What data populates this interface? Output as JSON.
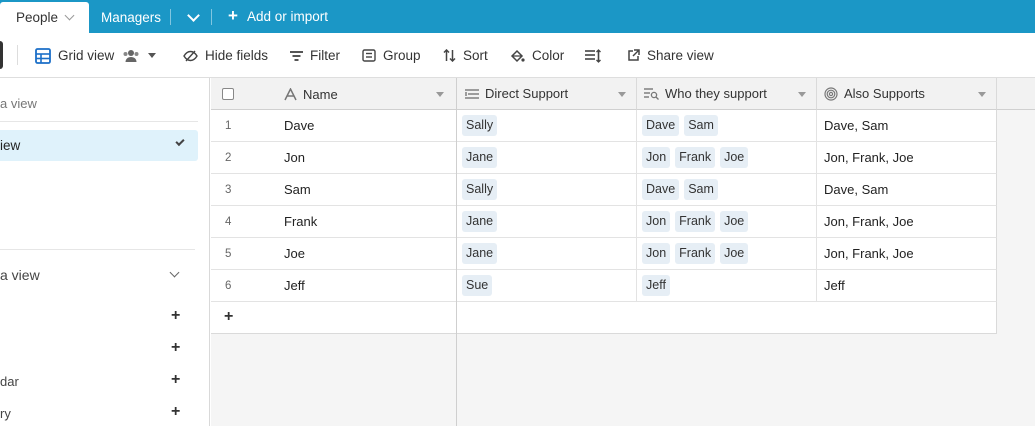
{
  "tabs": {
    "active": "People",
    "other": "Managers",
    "add_import": "Add or import"
  },
  "toolbar": {
    "view_name": "Grid view",
    "hide_fields": "Hide fields",
    "filter": "Filter",
    "group": "Group",
    "sort": "Sort",
    "color": "Color",
    "share_view": "Share view"
  },
  "sidebar": {
    "find_view": "a view",
    "active_view": "iew",
    "create_view": "a view",
    "create_items": [
      {
        "label": ""
      },
      {
        "label": ""
      },
      {
        "label": "dar"
      },
      {
        "label": "ry"
      }
    ]
  },
  "columns": {
    "name": "Name",
    "direct_support": "Direct Support",
    "who_they_support": "Who they support",
    "also_supports": "Also Supports"
  },
  "rows": [
    {
      "num": "1",
      "name": "Dave",
      "direct": [
        "Sally"
      ],
      "who": [
        "Dave",
        "Sam"
      ],
      "also": "Dave, Sam"
    },
    {
      "num": "2",
      "name": "Jon",
      "direct": [
        "Jane"
      ],
      "who": [
        "Jon",
        "Frank",
        "Joe"
      ],
      "also": "Jon, Frank, Joe"
    },
    {
      "num": "3",
      "name": "Sam",
      "direct": [
        "Sally"
      ],
      "who": [
        "Dave",
        "Sam"
      ],
      "also": "Dave, Sam"
    },
    {
      "num": "4",
      "name": "Frank",
      "direct": [
        "Jane"
      ],
      "who": [
        "Jon",
        "Frank",
        "Joe"
      ],
      "also": "Jon, Frank, Joe"
    },
    {
      "num": "5",
      "name": "Joe",
      "direct": [
        "Jane"
      ],
      "who": [
        "Jon",
        "Frank",
        "Joe"
      ],
      "also": "Jon, Frank, Joe"
    },
    {
      "num": "6",
      "name": "Jeff",
      "direct": [
        "Sue"
      ],
      "who": [
        "Jeff"
      ],
      "also": "Jeff"
    }
  ],
  "add_row_symbol": "+",
  "icons": {
    "grid": "grid-icon",
    "people": "people-icon",
    "hide": "hide-fields-icon",
    "filter": "filter-icon",
    "group": "group-icon",
    "sort": "sort-icon",
    "color": "paint-bucket-icon",
    "row_height": "row-height-icon",
    "share": "share-icon"
  },
  "colors": {
    "tabbar": "#1b97c6",
    "pill_bg": "#e6eef5",
    "sidebar_active": "#dff2fb",
    "grid_icon": "#1b6fc8"
  }
}
